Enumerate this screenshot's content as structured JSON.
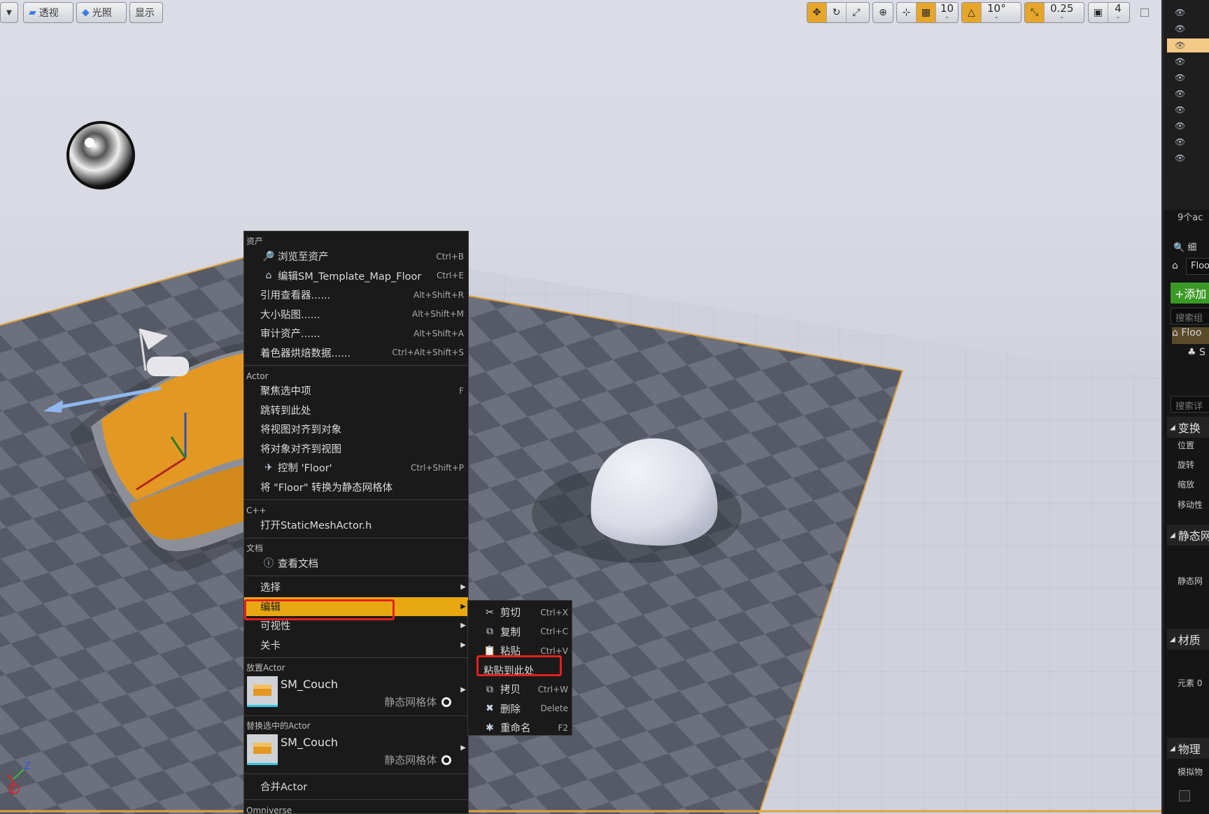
{
  "toolbar": {
    "perspective_label": "透视",
    "lit_label": "光照",
    "show_label": "显示",
    "grid_snap_value": "10",
    "rotation_snap_value": "10°",
    "scale_snap_value": "0.25",
    "camera_speed_value": "4",
    "accent_color": "#e5a62a"
  },
  "context_menu": {
    "sections": {
      "assets": "资产",
      "actor": "Actor",
      "cpp": "C++",
      "docs": "文档",
      "place_actor": "放置Actor",
      "replace_actor": "替换选中的Actor",
      "omniverse": "Omniverse"
    },
    "asset_items": [
      {
        "icon": "search-icon",
        "label": "浏览至资产",
        "shortcut": "Ctrl+B"
      },
      {
        "icon": "house-icon",
        "label": "编辑SM_Template_Map_Floor",
        "shortcut": "Ctrl+E"
      },
      {
        "icon": "",
        "label": "引用查看器......",
        "shortcut": "Alt+Shift+R"
      },
      {
        "icon": "",
        "label": "大小贴图......",
        "shortcut": "Alt+Shift+M"
      },
      {
        "icon": "",
        "label": "审计资产......",
        "shortcut": "Alt+Shift+A"
      },
      {
        "icon": "",
        "label": "着色器烘焙数据......",
        "shortcut": "Ctrl+Alt+Shift+S"
      }
    ],
    "actor_items": [
      {
        "icon": "",
        "label": "聚焦选中项",
        "shortcut": "F"
      },
      {
        "icon": "",
        "label": "跳转到此处",
        "shortcut": ""
      },
      {
        "icon": "",
        "label": "将视图对齐到对象",
        "shortcut": ""
      },
      {
        "icon": "",
        "label": "将对象对齐到视图",
        "shortcut": ""
      },
      {
        "icon": "plane-icon",
        "label": "控制 'Floor'",
        "shortcut": "Ctrl+Shift+P"
      },
      {
        "icon": "",
        "label": "将 \"Floor\" 转换为静态网格体",
        "shortcut": ""
      }
    ],
    "cpp_item": "打开StaticMeshActor.h",
    "docs_item": "查看文档",
    "submenus": [
      {
        "label": "选择"
      },
      {
        "label": "编辑",
        "highlighted": true
      },
      {
        "label": "可视性"
      },
      {
        "label": "关卡"
      }
    ],
    "place_asset": {
      "name": "SM_Couch",
      "type": "静态网格体"
    },
    "replace_asset": {
      "name": "SM_Couch",
      "type": "静态网格体"
    },
    "merge_item": "合并Actor",
    "highlight_color": "#e8a812"
  },
  "edit_submenu": [
    {
      "icon": "scissors-icon",
      "label": "剪切",
      "shortcut": "Ctrl+X"
    },
    {
      "icon": "copy-icon",
      "label": "复制",
      "shortcut": "Ctrl+C"
    },
    {
      "icon": "clipboard-icon",
      "label": "粘贴",
      "shortcut": "Ctrl+V"
    },
    {
      "icon": "",
      "label": "粘贴到此处",
      "shortcut": ""
    },
    {
      "icon": "duplicate-icon",
      "label": "拷贝",
      "shortcut": "Ctrl+W"
    },
    {
      "icon": "delete-icon",
      "label": "删除",
      "shortcut": "Delete"
    },
    {
      "icon": "rename-icon",
      "label": "重命名",
      "shortcut": "F2"
    }
  ],
  "right_panel": {
    "actor_count": "9个ac",
    "details_tab": "细",
    "selected_name": "Floo",
    "add_button": "+添加",
    "search_components": "搜索组",
    "component_root": "Floo",
    "component_child": "S",
    "search_details": "搜索详",
    "transform_section": "变换",
    "location_label": "位置",
    "rotation_label": "旋转",
    "scale_label": "缩放",
    "mobility_label": "移动性",
    "static_mesh_section": "静态网",
    "static_mesh_label": "静态网",
    "materials_section": "材质",
    "element_label": "元素 0",
    "physics_section": "物理",
    "simulate_label": "模拟物"
  }
}
